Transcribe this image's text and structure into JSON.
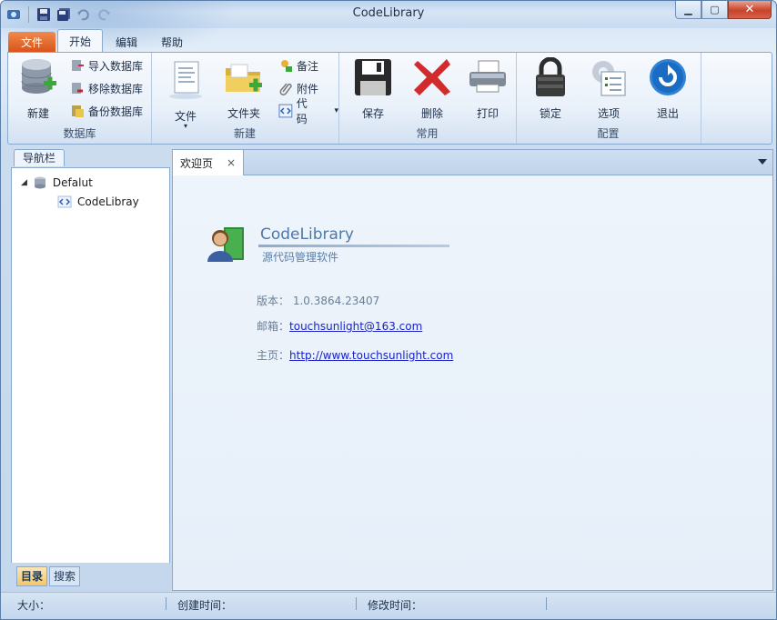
{
  "window": {
    "title": "CodeLibrary"
  },
  "ribbon_tabs": [
    {
      "label": "文件",
      "type": "file"
    },
    {
      "label": "开始",
      "type": "active"
    },
    {
      "label": "编辑",
      "type": "normal"
    },
    {
      "label": "帮助",
      "type": "normal"
    }
  ],
  "groups": {
    "database": {
      "label": "数据库",
      "new": "新建",
      "import": "导入数据库",
      "remove": "移除数据库",
      "backup": "备份数据库"
    },
    "create": {
      "label": "新建",
      "file": "文件",
      "folder": "文件夹",
      "note": "备注",
      "attachment": "附件",
      "code": "代码"
    },
    "common": {
      "label": "常用",
      "save": "保存",
      "delete": "删除",
      "print": "打印"
    },
    "config": {
      "label": "配置",
      "lock": "锁定",
      "options": "选项",
      "exit": "退出"
    }
  },
  "nav": {
    "title": "导航栏",
    "tree": [
      {
        "label": "Defalut"
      },
      {
        "label": "CodeLibray"
      }
    ],
    "bottom_tabs": [
      {
        "label": "目录"
      },
      {
        "label": "搜索"
      }
    ]
  },
  "doc": {
    "tab_label": "欢迎页",
    "close": "×",
    "app_name": "CodeLibrary",
    "app_desc": "源代码管理软件",
    "version_label": "版本：",
    "version_value": "1.0.3864.23407",
    "email_label": "邮箱：",
    "email_value": "touchsunlight@163.com",
    "home_label": "主页：",
    "home_value": "http://www.touchsunlight.com"
  },
  "status": {
    "size": "大小：",
    "created": "创建时间：",
    "modified": "修改时间："
  },
  "colors": {
    "file_tab": "#d9541b",
    "accent": "#4e78a8",
    "link": "#1a23c8"
  }
}
